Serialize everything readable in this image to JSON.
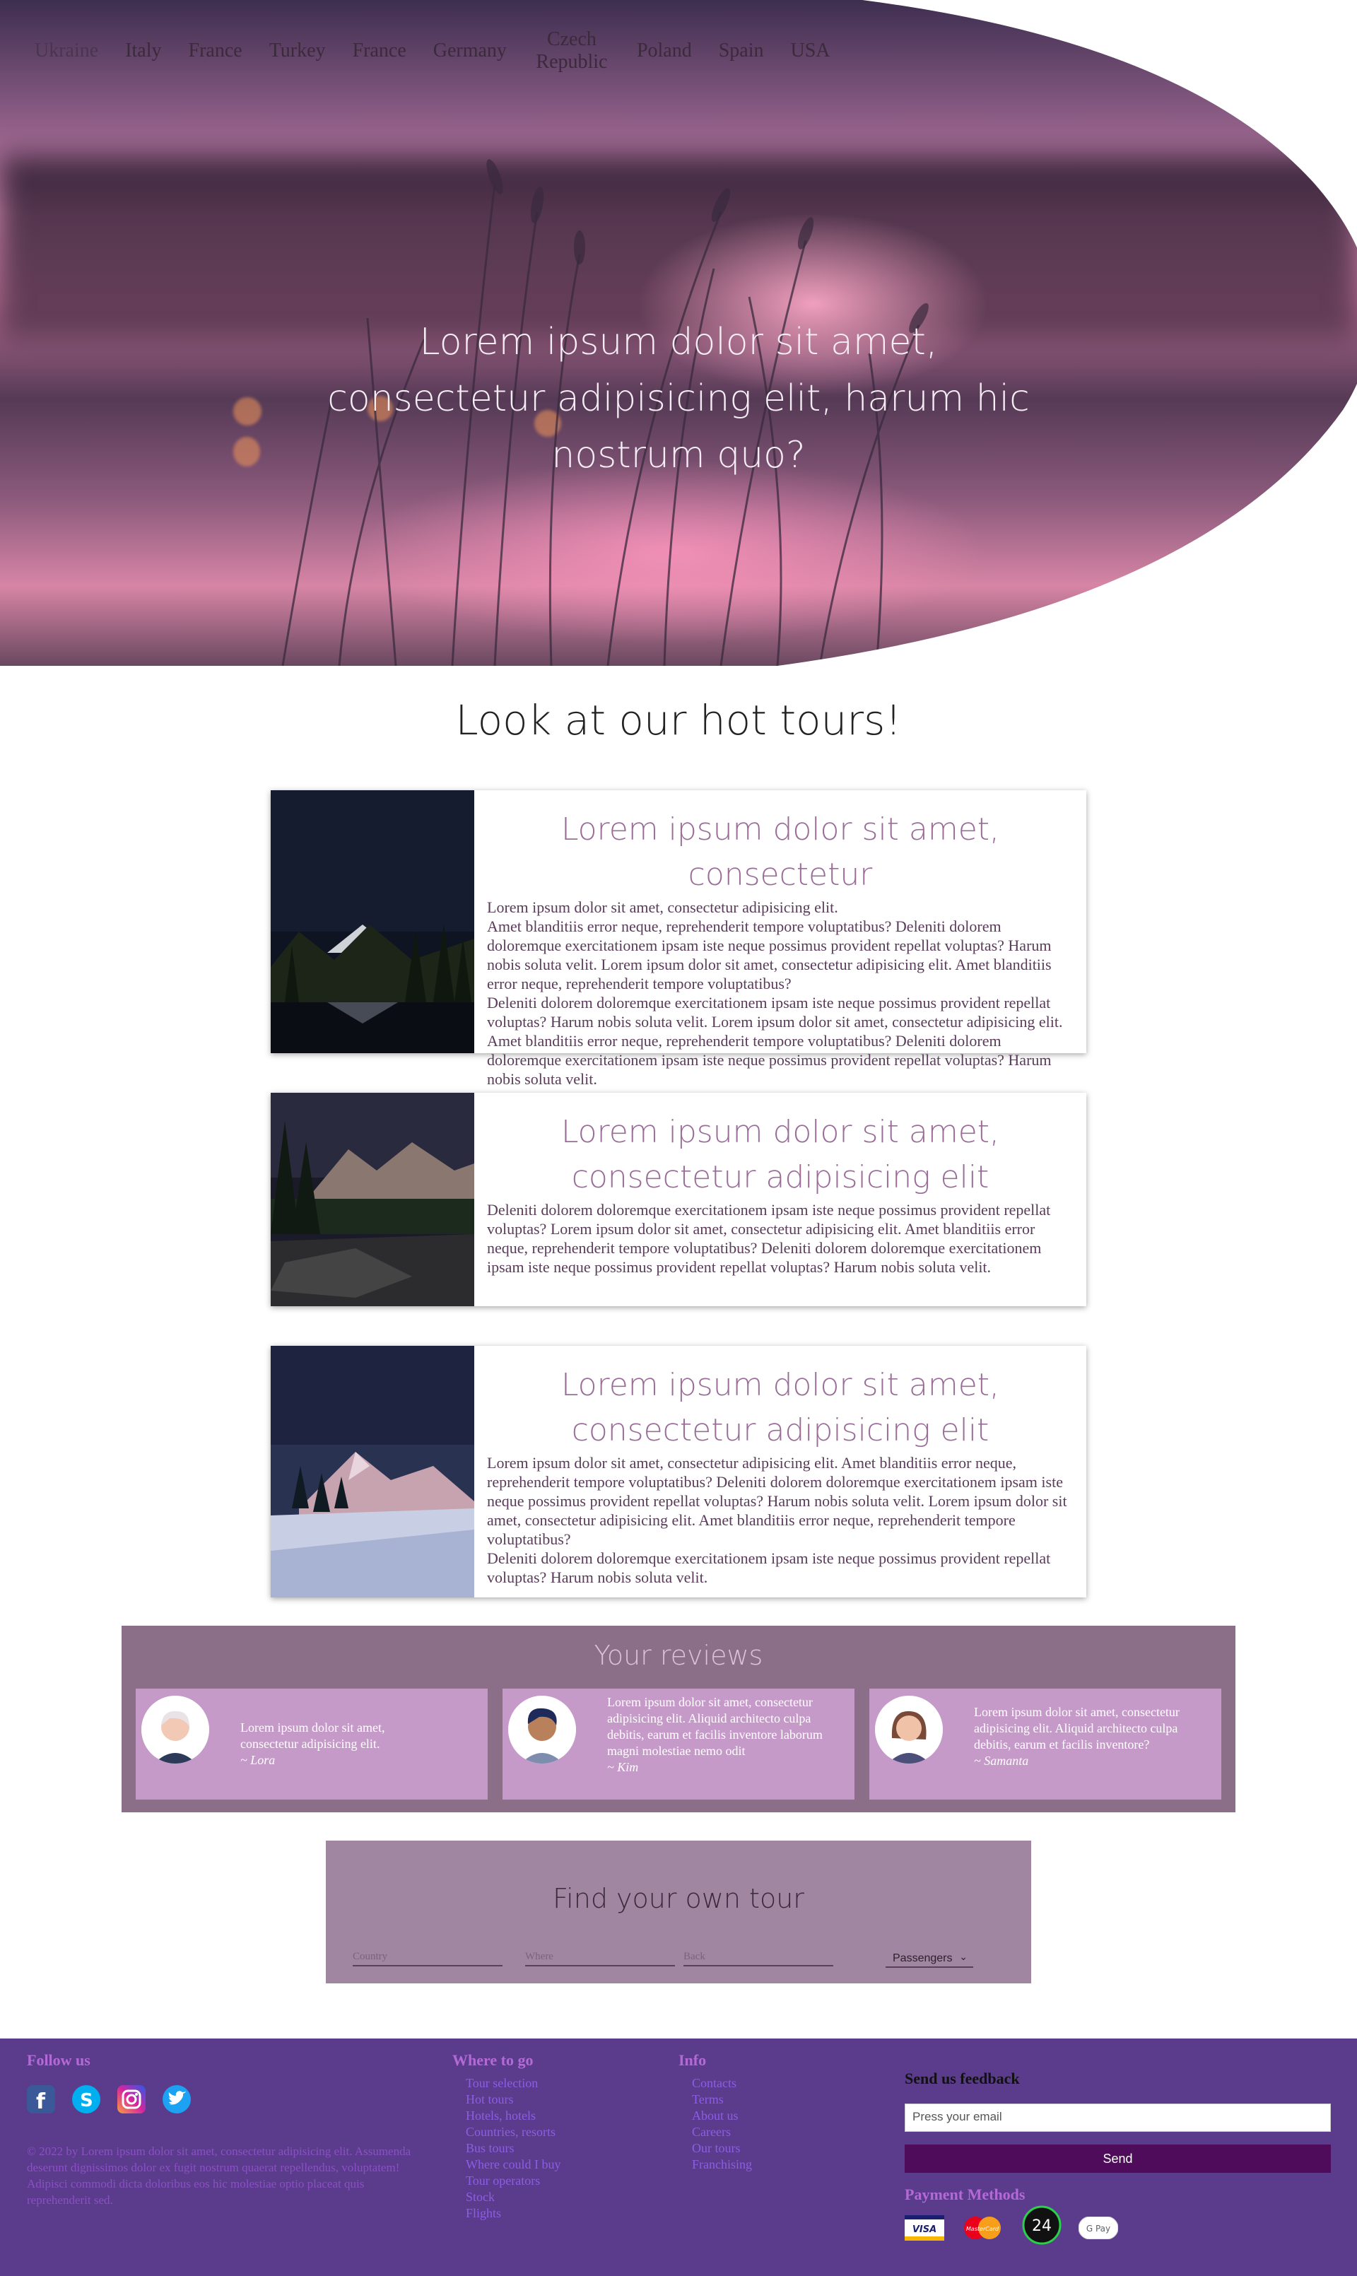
{
  "nav": {
    "items": [
      "Ukraine",
      "Italy",
      "France",
      "Turkey",
      "France",
      "Germany",
      "Czech Republic",
      "Poland",
      "Spain",
      "USA"
    ]
  },
  "hero": {
    "title": "Lorem ipsum dolor sit amet, consectetur adipisicing elit, harum hic nostrum quo?"
  },
  "tours": {
    "title": "Look at our hot tours!",
    "cards": [
      {
        "heading": "Lorem ipsum dolor sit amet, consectetur",
        "text": "Lorem ipsum dolor sit amet, consectetur adipisicing elit.\nAmet blanditiis error neque, reprehenderit tempore voluptatibus? Deleniti dolorem doloremque exercitationem ipsam iste neque possimus provident repellat voluptas? Harum nobis soluta velit. Lorem ipsum dolor sit amet, consectetur adipisicing elit. Amet blanditiis error neque, reprehenderit tempore voluptatibus?\nDeleniti dolorem doloremque exercitationem ipsam iste neque possimus provident repellat voluptas? Harum nobis soluta velit. Lorem ipsum dolor sit amet, consectetur adipisicing elit. Amet blanditiis error neque, reprehenderit tempore voluptatibus? Deleniti dolorem doloremque exercitationem ipsam iste neque possimus provident repellat voluptas? Harum nobis soluta velit."
      },
      {
        "heading": "Lorem ipsum dolor sit amet, consectetur adipisicing elit",
        "text": "Deleniti dolorem doloremque exercitationem ipsam iste neque possimus provident repellat voluptas? Lorem ipsum dolor sit amet, consectetur adipisicing elit. Amet blanditiis error neque, reprehenderit tempore voluptatibus? Deleniti dolorem doloremque exercitationem ipsam iste neque possimus provident repellat voluptas? Harum nobis soluta velit."
      },
      {
        "heading": "Lorem ipsum dolor sit amet, consectetur adipisicing elit",
        "text": "Lorem ipsum dolor sit amet, consectetur adipisicing elit. Amet blanditiis error neque, reprehenderit tempore voluptatibus? Deleniti dolorem doloremque exercitationem ipsam iste neque possimus provident repellat voluptas? Harum nobis soluta velit. Lorem ipsum dolor sit amet, consectetur adipisicing elit. Amet blanditiis error neque, reprehenderit tempore voluptatibus?\nDeleniti dolorem doloremque exercitationem ipsam iste neque possimus provident repellat voluptas? Harum nobis soluta velit."
      }
    ]
  },
  "reviews": {
    "title": "Your reviews",
    "items": [
      {
        "text": "Lorem ipsum dolor sit amet, consectetur adipisicing elit.",
        "author": "~ Lora"
      },
      {
        "text": "Lorem ipsum dolor sit amet, consectetur adipisicing elit. Aliquid architecto culpa debitis, earum et facilis inventore laborum magni molestiae nemo odit",
        "author": "~ Kim"
      },
      {
        "text": "Lorem ipsum dolor sit amet, consectetur adipisicing elit. Aliquid architecto culpa debitis, earum et facilis inventore?",
        "author": "~ Samanta"
      }
    ]
  },
  "find": {
    "title": "Find your own tour",
    "country_placeholder": "Country",
    "where_placeholder": "Where",
    "back_placeholder": "Back",
    "passengers": "Passengers"
  },
  "footer": {
    "follow_title": "Follow us",
    "copyright": "© 2022 by Lorem ipsum dolor sit amet, consectetur adipisicing elit. Assumenda deserunt dignissimos dolor ex fugit nostrum quaerat repellendus, voluptatem! Adipisci commodi dicta doloribus eos hic molestiae optio placeat quis reprehenderit sed.",
    "where_title": "Where to go",
    "where_links": [
      "Tour selection",
      "Hot tours",
      "Hotels, hotels",
      "Countries, resorts",
      "Bus tours",
      "Where could I buy",
      "Tour operators",
      "Stock",
      "Flights"
    ],
    "info_title": "Info",
    "info_links": [
      "Contacts",
      "Terms",
      "About us",
      "Careers",
      "Our tours",
      "Franchising"
    ],
    "feedback_title": "Send us feedback",
    "email_placeholder": "Press your email",
    "send_label": "Send",
    "payment_title": "Payment Methods",
    "payment_methods": [
      "VISA",
      "MasterCard",
      "24",
      "G Pay"
    ]
  },
  "colors": {
    "accent": "#9a6d98",
    "footer_bg": "#5b3b8b",
    "send_bg": "#4f0c5a",
    "reviews_bg": "#8b6f88",
    "review_card_bg": "#c599c8",
    "find_bg": "#a086a0"
  }
}
